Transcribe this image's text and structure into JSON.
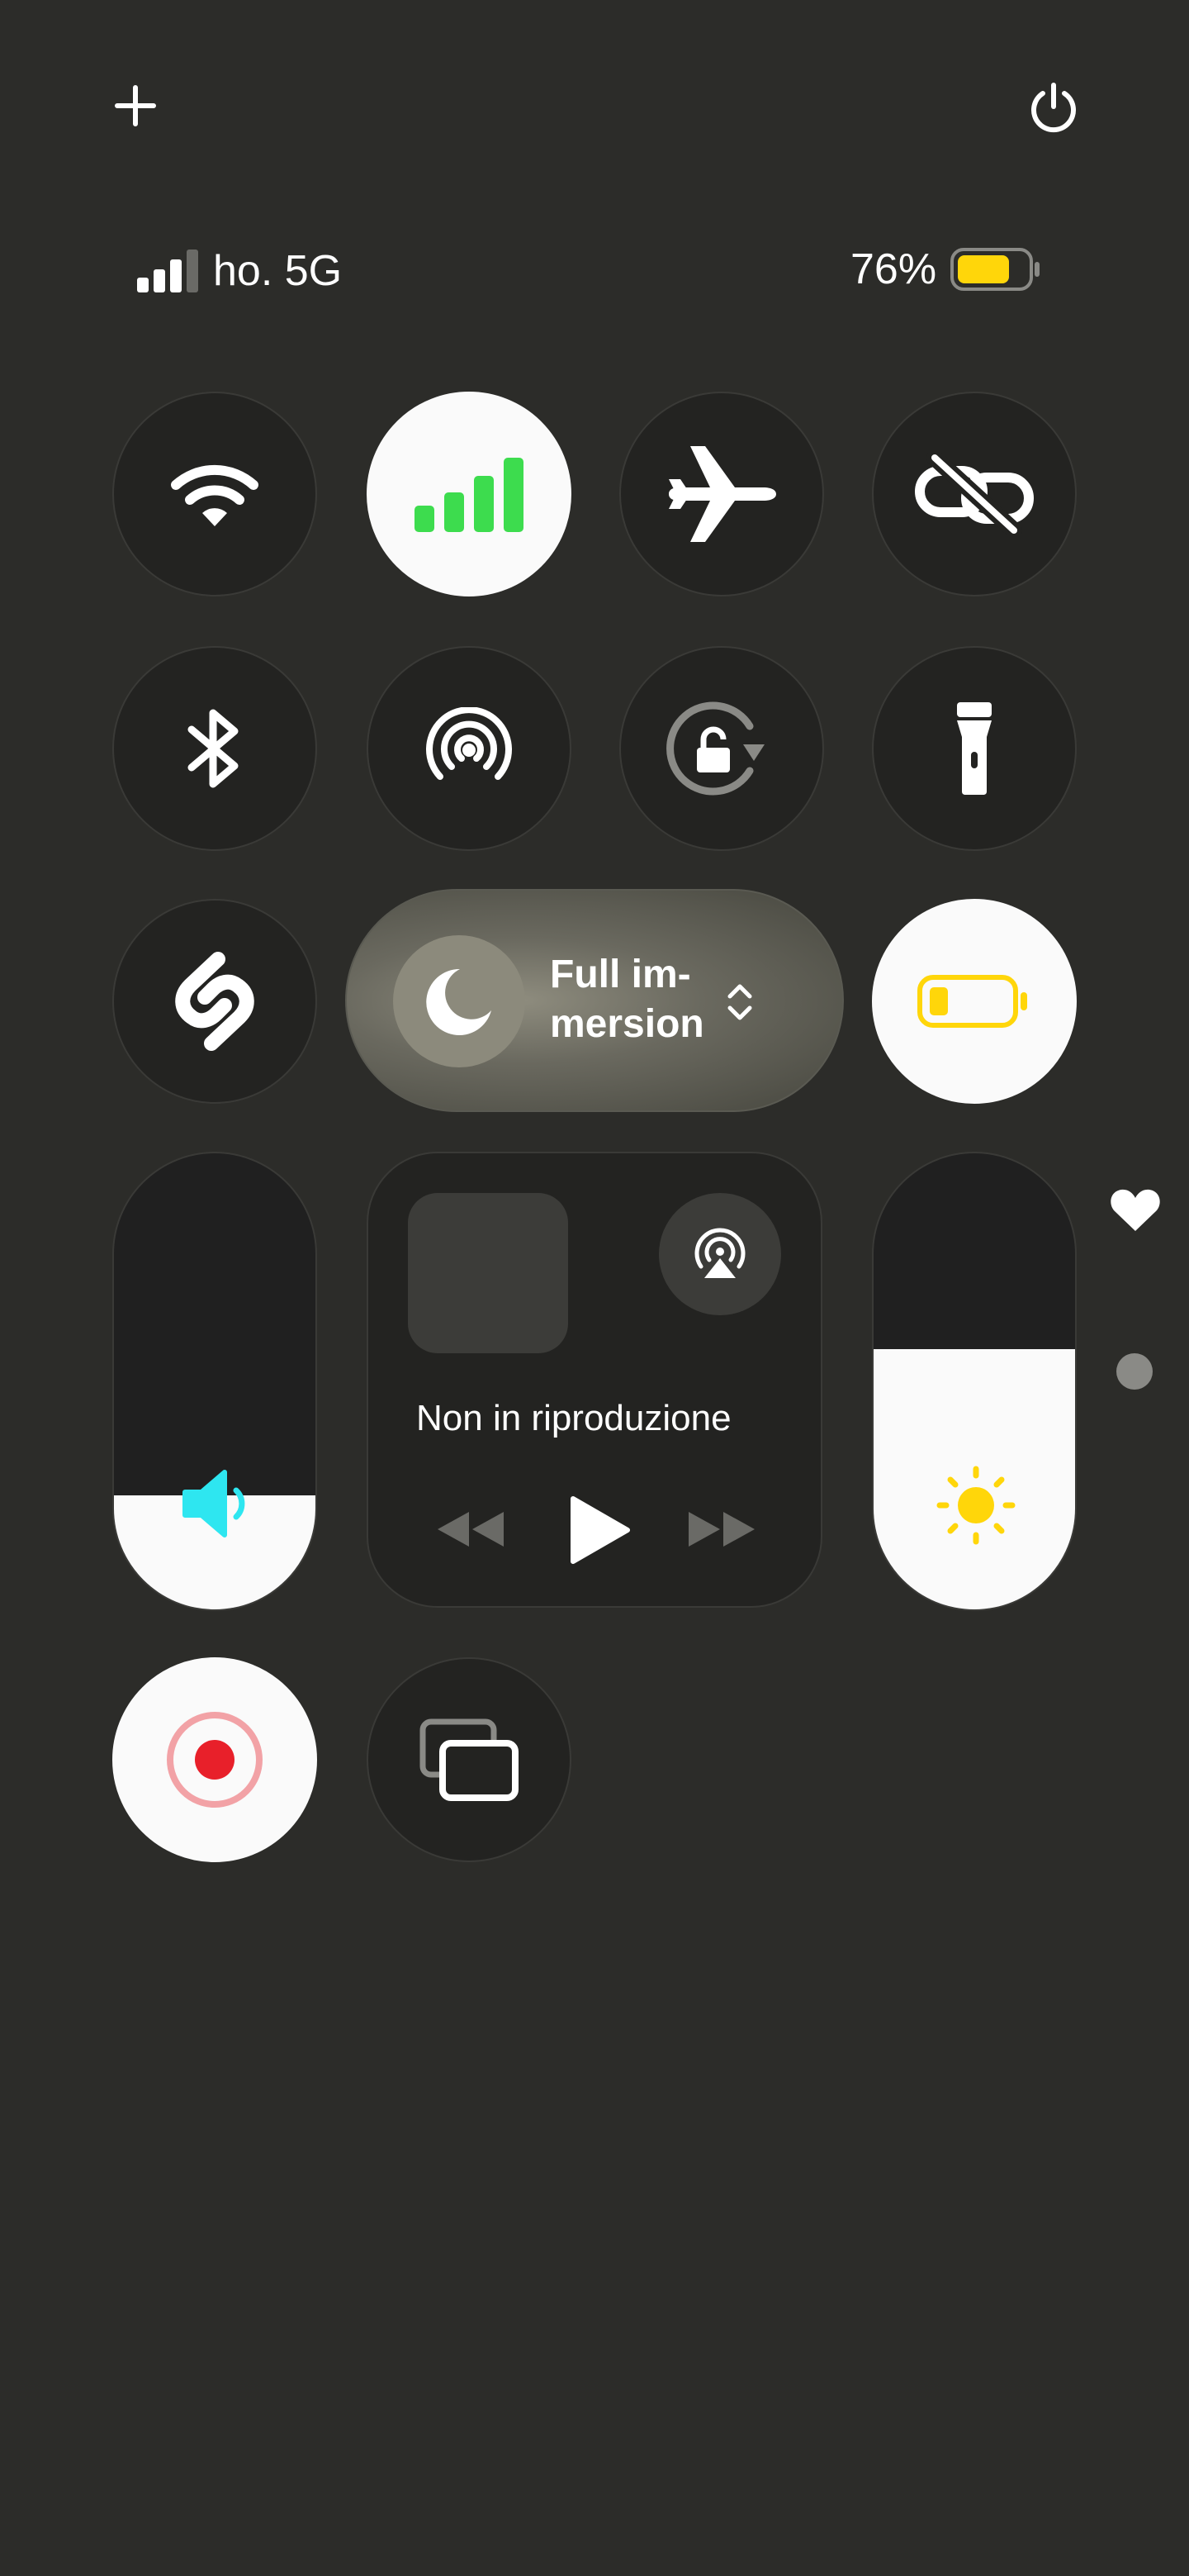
{
  "status": {
    "carrier": "ho. 5G",
    "battery_percent": "76%",
    "battery_level": 0.76
  },
  "focus": {
    "label_line1": "Full im-",
    "label_line2": "mersion"
  },
  "media": {
    "now_playing": "Non in riproduzione"
  },
  "sliders": {
    "volume_level": 0.25,
    "brightness_level": 0.57
  },
  "colors": {
    "background": "#2c2c29",
    "cellular_green": "#3ddc4e",
    "volume_cyan": "#2ee6f0",
    "brightness_yellow": "#ffd60a",
    "battery_yellow": "#ffd60a",
    "record_red": "#e8202a"
  },
  "icons": [
    "plus-icon",
    "power-icon",
    "wifi-icon",
    "cellular-icon",
    "airplane-icon",
    "unlink-icon",
    "bluetooth-icon",
    "hotspot-icon",
    "rotation-lock-icon",
    "flashlight-icon",
    "shazam-icon",
    "moon-icon",
    "chevron-updown-icon",
    "low-power-battery-icon",
    "speaker-icon",
    "airplay-icon",
    "rewind-icon",
    "play-icon",
    "fast-forward-icon",
    "sun-icon",
    "record-icon",
    "screen-mirror-icon",
    "heart-icon",
    "page-dot"
  ]
}
